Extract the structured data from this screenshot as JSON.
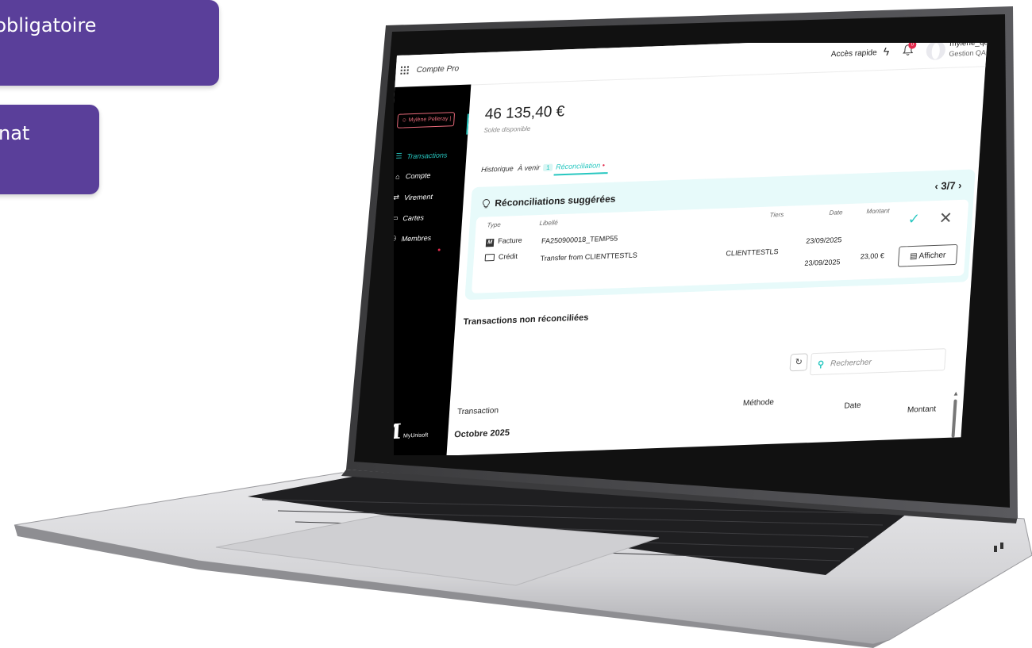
{
  "callouts": {
    "first": "ps obligatoire",
    "second": "nat"
  },
  "app": {
    "name": "Compte Pro",
    "quick_access": "Accès rapide",
    "notifications_count": "0",
    "user_name": "mylene_qa",
    "user_role": "Gestion QA"
  },
  "sidebar": {
    "user_chip": "Mylène Pelleray",
    "items": [
      {
        "label": "Transactions",
        "icon": "list-icon"
      },
      {
        "label": "Compte",
        "icon": "bank-icon"
      },
      {
        "label": "Virement",
        "icon": "transfer-icon"
      },
      {
        "label": "Cartes",
        "icon": "card-icon"
      },
      {
        "label": "Membres",
        "icon": "members-icon"
      }
    ],
    "brand": "MyUnisoft"
  },
  "balance": {
    "amount": "46 135,40 €",
    "label": "Solde disponible"
  },
  "tabs": {
    "history": "Historique",
    "upcoming": "À venir",
    "upcoming_count": "1",
    "reconciliation": "Réconciliation"
  },
  "suggestions": {
    "title": "Réconciliations suggérées",
    "pager": "3/7",
    "columns": {
      "type": "Type",
      "label": "Libellé",
      "third_party": "Tiers",
      "date": "Date",
      "amount": "Montant"
    },
    "rows": [
      {
        "type": "Facture",
        "label": "FA250900018_TEMP55",
        "third_party": "",
        "date": "23/09/2025",
        "amount": ""
      },
      {
        "type": "Crédit",
        "label": "Transfer from CLIENTTESTLS",
        "third_party": "CLIENTTESTLS",
        "date": "23/09/2025",
        "amount": "23,00 €"
      }
    ],
    "show_button": "Afficher"
  },
  "unreconciled": {
    "title": "Transactions non réconciliées",
    "search_placeholder": "Rechercher",
    "columns": {
      "transaction": "Transaction",
      "method": "Méthode",
      "date": "Date",
      "amount": "Montant"
    },
    "month": "Octobre 2025"
  },
  "colors": {
    "accent": "#27c7c0",
    "callout": "#5a3f9a",
    "alert": "#e22b4d"
  }
}
